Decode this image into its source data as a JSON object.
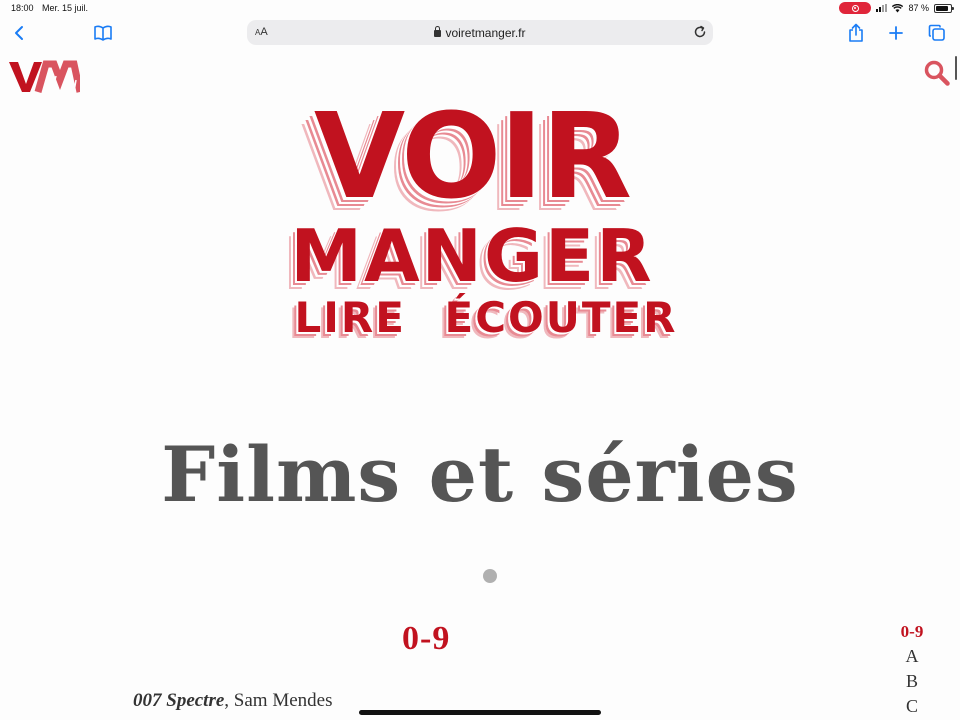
{
  "status_bar": {
    "time": "18:00",
    "date": "Mer. 15 juil.",
    "battery": "87 %",
    "battery_level": 0.87
  },
  "browser": {
    "text_size_label": "AA",
    "url": "voiretmanger.fr",
    "icons": [
      "chevron-left-icon",
      "book-icon",
      "lock-icon",
      "reload-icon",
      "share-icon",
      "plus-icon",
      "tabs-icon"
    ],
    "accent_color": "#1a7cf5"
  },
  "site": {
    "logo_text": "VM",
    "hero": {
      "line1": "VOIR",
      "line2": "MANGER",
      "line3": "LIRE ÉCOUTER"
    },
    "brand_color": "#c1121f",
    "page_title": "Films et séries",
    "section_heading": "0-9",
    "alpha_index": [
      "0-9",
      "A",
      "B",
      "C"
    ],
    "active_index": "0-9",
    "first_item": {
      "title": "007 Spectre",
      "director": ", Sam Mendes"
    }
  }
}
